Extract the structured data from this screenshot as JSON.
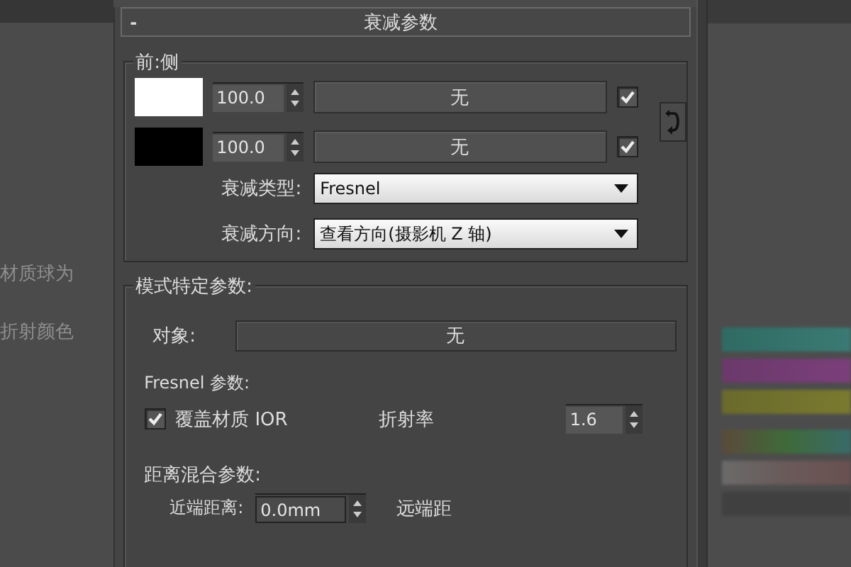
{
  "background_texts": [
    "材质球为",
    "折射颜色"
  ],
  "rollout": {
    "collapse_symbol": "-",
    "title": "衰减参数"
  },
  "front_side": {
    "title": "前:侧",
    "rows": [
      {
        "color": "#ffffff",
        "amount": "100.0",
        "map": "无",
        "enabled": true
      },
      {
        "color": "#000000",
        "amount": "100.0",
        "map": "无",
        "enabled": true
      }
    ],
    "falloff_type": {
      "label": "衰减类型:",
      "value": "Fresnel"
    },
    "falloff_direction": {
      "label": "衰减方向:",
      "value": "查看方向(摄影机 Z 轴)"
    }
  },
  "mode_params": {
    "title": "模式特定参数:",
    "object": {
      "label": "对象:",
      "value": "无"
    },
    "fresnel": {
      "title": "Fresnel 参数:",
      "override": {
        "label": "覆盖材质 IOR",
        "checked": true
      },
      "ior": {
        "label": "折射率",
        "value": "1.6"
      }
    },
    "distance": {
      "title": "距离混合参数:",
      "near": {
        "label": "近端距离:",
        "value": "0.0mm"
      },
      "far_label": "远端距"
    }
  }
}
